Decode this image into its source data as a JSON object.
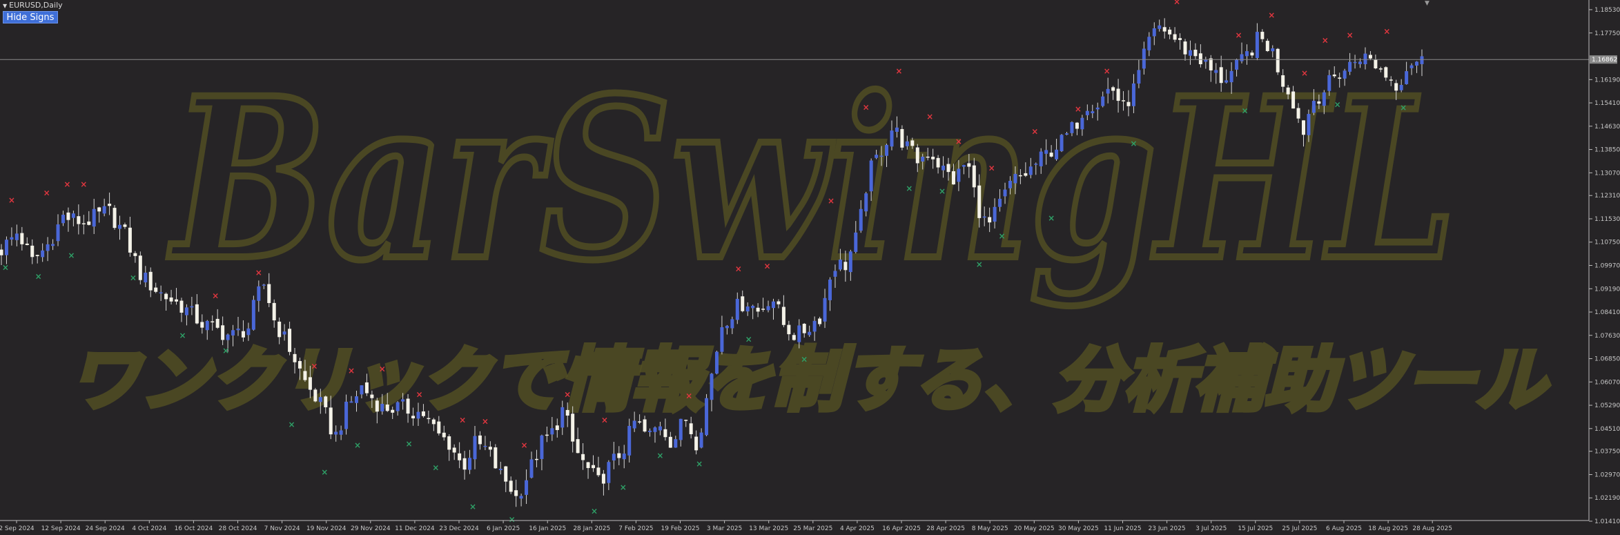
{
  "window": {
    "symbol_title": "EURUSD,Daily",
    "collapse_icon": "triangle-down-icon",
    "hide_signs_label": "Hide Signs",
    "corner_icon": "chevron-down-icon"
  },
  "watermark": {
    "title": "BarSwingHL",
    "subtitle": "ワンクリックで情報を制する、分析補助ツール"
  },
  "colors": {
    "background": "#262426",
    "bull_candle": "#4a67d8",
    "bear_candle": "#f4f2e8",
    "swing_high_mark": "#e0363f",
    "swing_low_mark": "#2e9f66",
    "watermark_outline": "#545023",
    "axis_text": "#c8c8c8",
    "price_line": "#8a8a8a",
    "current_price_bg": "#8a8a8a"
  },
  "chart_data": {
    "type": "candlestick",
    "symbol": "EURUSD",
    "timeframe": "Daily",
    "ylim": [
      1.0105,
      1.19
    ],
    "current_price": "1.16862",
    "current_price_value": 1.16862,
    "y_ticks": [
      "1.18530",
      "1.17750",
      "1.16190",
      "1.15410",
      "1.14630",
      "1.13850",
      "1.13070",
      "1.12310",
      "1.11530",
      "1.10750",
      "1.09970",
      "1.09190",
      "1.08410",
      "1.07630",
      "1.06850",
      "1.06070",
      "1.05290",
      "1.04510",
      "1.03750",
      "1.02970",
      "1.02190",
      "1.01410"
    ],
    "x_ticks": [
      "2 Sep 2024",
      "12 Sep 2024",
      "24 Sep 2024",
      "4 Oct 2024",
      "16 Oct 2024",
      "28 Oct 2024",
      "7 Nov 2024",
      "19 Nov 2024",
      "29 Nov 2024",
      "11 Dec 2024",
      "23 Dec 2024",
      "6 Jan 2025",
      "16 Jan 2025",
      "28 Jan 2025",
      "7 Feb 2025",
      "19 Feb 2025",
      "3 Mar 2025",
      "13 Mar 2025",
      "25 Mar 2025",
      "4 Apr 2025",
      "16 Apr 2025",
      "28 Apr 2025",
      "8 May 2025",
      "20 May 2025",
      "30 May 2025",
      "11 Jun 2025",
      "23 Jun 2025",
      "3 Jul 2025",
      "15 Jul 2025",
      "25 Jul 2025",
      "6 Aug 2025",
      "18 Aug 2025",
      "28 Aug 2025"
    ],
    "close_path": [
      [
        0,
        1.105
      ],
      [
        8,
        1.111
      ],
      [
        15,
        1.101
      ],
      [
        22,
        1.106
      ],
      [
        30,
        1.116
      ],
      [
        40,
        1.114
      ],
      [
        52,
        1.118
      ],
      [
        60,
        1.11
      ],
      [
        68,
        1.096
      ],
      [
        78,
        1.09
      ],
      [
        88,
        1.086
      ],
      [
        98,
        1.08
      ],
      [
        112,
        1.076
      ],
      [
        120,
        1.079
      ],
      [
        124,
        1.089
      ],
      [
        128,
        1.094
      ],
      [
        132,
        1.082
      ],
      [
        140,
        1.072
      ],
      [
        148,
        1.06
      ],
      [
        156,
        1.052
      ],
      [
        162,
        1.042
      ],
      [
        168,
        1.052
      ],
      [
        175,
        1.059
      ],
      [
        185,
        1.052
      ],
      [
        195,
        1.052
      ],
      [
        205,
        1.05
      ],
      [
        212,
        1.043
      ],
      [
        218,
        1.04
      ],
      [
        224,
        1.032
      ],
      [
        230,
        1.04
      ],
      [
        236,
        1.038
      ],
      [
        242,
        1.03
      ],
      [
        247,
        1.026
      ],
      [
        250,
        1.022
      ],
      [
        256,
        1.03
      ],
      [
        262,
        1.04
      ],
      [
        268,
        1.044
      ],
      [
        273,
        1.052
      ],
      [
        278,
        1.039
      ],
      [
        284,
        1.032
      ],
      [
        290,
        1.027
      ],
      [
        296,
        1.033
      ],
      [
        302,
        1.038
      ],
      [
        308,
        1.048
      ],
      [
        314,
        1.042
      ],
      [
        320,
        1.047
      ],
      [
        326,
        1.04
      ],
      [
        332,
        1.049
      ],
      [
        338,
        1.04
      ],
      [
        344,
        1.06
      ],
      [
        350,
        1.08
      ],
      [
        356,
        1.085
      ],
      [
        362,
        1.088
      ],
      [
        368,
        1.084
      ],
      [
        374,
        1.09
      ],
      [
        380,
        1.08
      ],
      [
        386,
        1.076
      ],
      [
        392,
        1.079
      ],
      [
        398,
        1.083
      ],
      [
        404,
        1.1
      ],
      [
        410,
        1.1
      ],
      [
        416,
        1.11
      ],
      [
        421,
        1.13
      ],
      [
        427,
        1.138
      ],
      [
        433,
        1.146
      ],
      [
        439,
        1.14
      ],
      [
        445,
        1.135
      ],
      [
        451,
        1.138
      ],
      [
        457,
        1.132
      ],
      [
        463,
        1.128
      ],
      [
        469,
        1.135
      ],
      [
        474,
        1.12
      ],
      [
        479,
        1.112
      ],
      [
        485,
        1.12
      ],
      [
        491,
        1.128
      ],
      [
        497,
        1.13
      ],
      [
        503,
        1.134
      ],
      [
        509,
        1.138
      ],
      [
        515,
        1.141
      ],
      [
        521,
        1.146
      ],
      [
        527,
        1.154
      ],
      [
        533,
        1.154
      ],
      [
        539,
        1.16
      ],
      [
        545,
        1.152
      ],
      [
        551,
        1.16
      ],
      [
        557,
        1.174
      ],
      [
        563,
        1.18
      ],
      [
        569,
        1.176
      ],
      [
        575,
        1.172
      ],
      [
        581,
        1.17
      ],
      [
        587,
        1.165
      ],
      [
        593,
        1.162
      ],
      [
        599,
        1.165
      ],
      [
        605,
        1.17
      ],
      [
        611,
        1.176
      ],
      [
        617,
        1.172
      ],
      [
        622,
        1.162
      ],
      [
        627,
        1.156
      ],
      [
        632,
        1.144
      ],
      [
        637,
        1.155
      ],
      [
        642,
        1.158
      ],
      [
        648,
        1.163
      ],
      [
        654,
        1.166
      ],
      [
        660,
        1.17
      ],
      [
        666,
        1.168
      ],
      [
        672,
        1.164
      ],
      [
        678,
        1.16
      ],
      [
        684,
        1.168
      ],
      [
        690,
        1.168
      ]
    ],
    "swing_highs": [
      [
        5,
        1.1215
      ],
      [
        22,
        1.124
      ],
      [
        32,
        1.1268
      ],
      [
        40,
        1.1268
      ],
      [
        104,
        1.0895
      ],
      [
        125,
        1.0973
      ],
      [
        152,
        1.066
      ],
      [
        170,
        1.0645
      ],
      [
        185,
        1.065
      ],
      [
        203,
        1.0565
      ],
      [
        224,
        1.048
      ],
      [
        235,
        1.0475
      ],
      [
        254,
        1.0395
      ],
      [
        275,
        1.0565
      ],
      [
        293,
        1.048
      ],
      [
        334,
        1.056
      ],
      [
        358,
        1.0985
      ],
      [
        372,
        1.0995
      ],
      [
        403,
        1.1213
      ],
      [
        420,
        1.1526
      ],
      [
        436,
        1.1647
      ],
      [
        451,
        1.1495
      ],
      [
        465,
        1.1412
      ],
      [
        481,
        1.1323
      ],
      [
        502,
        1.1445
      ],
      [
        523,
        1.152
      ],
      [
        537,
        1.1647
      ],
      [
        571,
        1.188
      ],
      [
        601,
        1.1768
      ],
      [
        617,
        1.1835
      ],
      [
        633,
        1.164
      ],
      [
        643,
        1.175
      ],
      [
        655,
        1.1768
      ],
      [
        673,
        1.178
      ]
    ],
    "swing_lows": [
      [
        2,
        1.099
      ],
      [
        18,
        1.096
      ],
      [
        34,
        1.103
      ],
      [
        64,
        1.0955
      ],
      [
        88,
        1.0763
      ],
      [
        109,
        1.0712
      ],
      [
        141,
        1.0465
      ],
      [
        157,
        1.0305
      ],
      [
        173,
        1.0395
      ],
      [
        198,
        1.04
      ],
      [
        211,
        1.032
      ],
      [
        229,
        1.019
      ],
      [
        248,
        1.0147
      ],
      [
        288,
        1.0175
      ],
      [
        302,
        1.0254
      ],
      [
        320,
        1.036
      ],
      [
        339,
        1.0333
      ],
      [
        363,
        1.075
      ],
      [
        390,
        1.0683
      ],
      [
        441,
        1.1255
      ],
      [
        457,
        1.1245
      ],
      [
        475,
        1.1
      ],
      [
        486,
        1.1095
      ],
      [
        510,
        1.1155
      ],
      [
        550,
        1.1405
      ],
      [
        604,
        1.1515
      ],
      [
        649,
        1.1535
      ],
      [
        681,
        1.1525
      ]
    ]
  }
}
